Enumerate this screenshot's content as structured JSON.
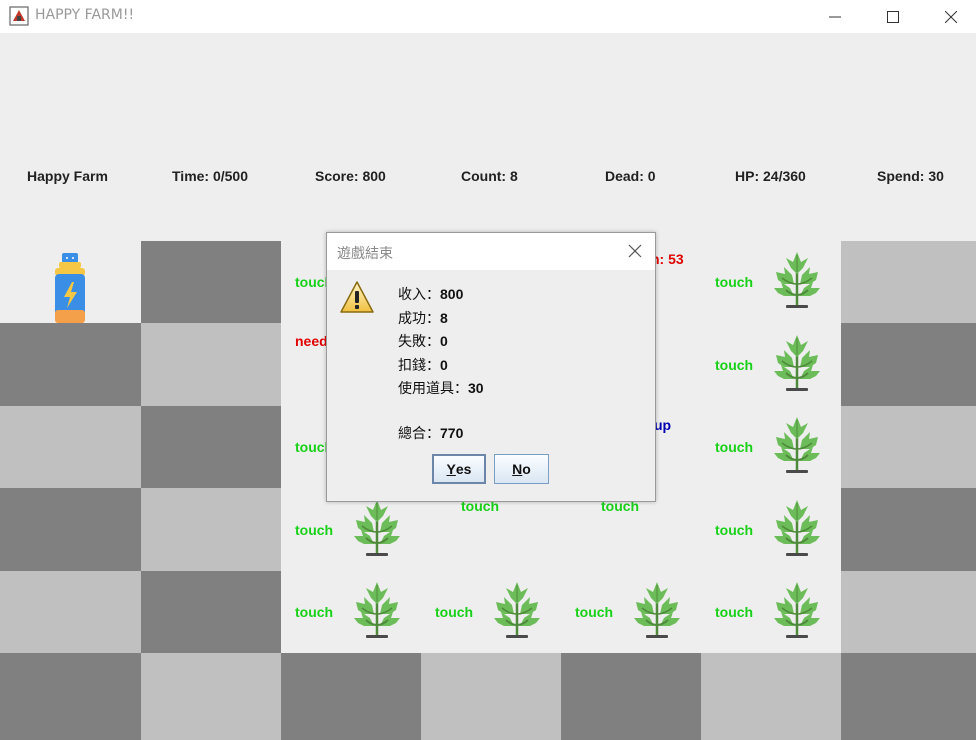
{
  "window": {
    "title": "HAPPY FARM!!"
  },
  "stats": {
    "name": "Happy Farm",
    "time": "Time: 0/500",
    "score": "Score: 800",
    "count": "Count: 8",
    "dead": "Dead: 0",
    "hp": "HP: 24/360",
    "spend": "Spend: 30"
  },
  "field": {
    "touch_label": "touch",
    "need_label": "need",
    "partial_label_53": "n: 53",
    "partial_label_up": "up"
  },
  "dialog": {
    "title": "遊戲結束",
    "lines": {
      "income_label": "收入：",
      "income_value": "800",
      "success_label": "成功：",
      "success_value": "8",
      "fail_label": "失敗：",
      "fail_value": "0",
      "deduct_label": "扣錢：",
      "deduct_value": "0",
      "items_label": "使用道具：",
      "items_value": "30",
      "total_label": "總合：",
      "total_value": "770"
    },
    "yes_mnemonic": "Y",
    "yes_rest": "es",
    "no_mnemonic": "N",
    "no_rest": "o"
  },
  "colors": {
    "touch": "#19d119",
    "alert": "#e00000",
    "tile_dark": "#808080",
    "tile_light": "#c0c0c0"
  },
  "icons": {
    "item": "energy-drink-icon",
    "crop": "hemp-plant-icon",
    "dialog": "warning-icon"
  }
}
